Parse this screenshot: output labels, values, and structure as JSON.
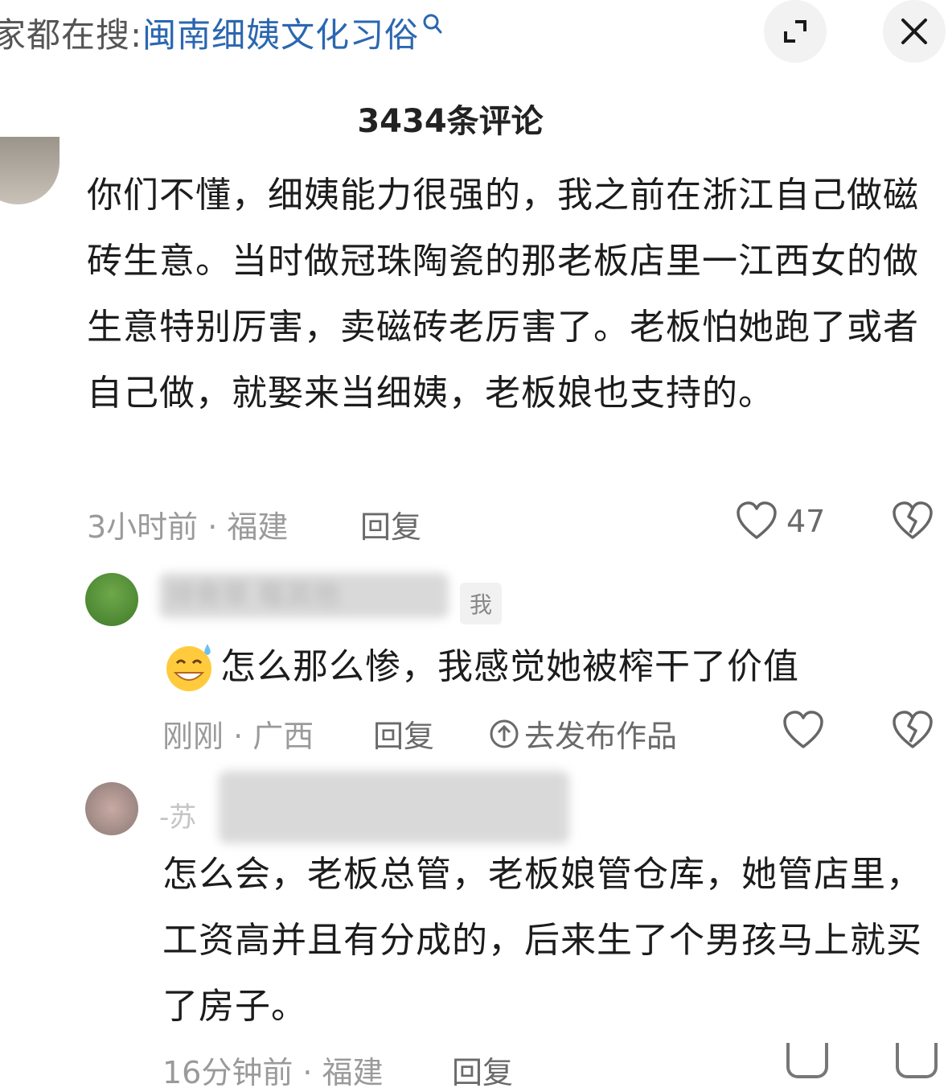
{
  "search": {
    "prefix": "家都在搜:",
    "query": "闽南细姨文化习俗"
  },
  "header": {
    "comment_count": "3434条评论"
  },
  "comments": [
    {
      "text": "你们不懂，细姨能力很强的，我之前在浙江自己做磁砖生意。当时做冠珠陶瓷的那老板店里一江西女的做生意特别厉害，卖磁砖老厉害了。老板怕她跑了或者自己做，就娶来当细姨，老板娘也支持的。",
      "meta": "3小时前 · 福建",
      "reply": "回复",
      "likes": "47"
    },
    {
      "username": "排骨草 莓其他",
      "me_tag": "我",
      "text": "怎么那么惨，我感觉她被榨干了价值",
      "meta": "刚刚 · 广西",
      "reply": "回复",
      "publish": "去发布作品"
    },
    {
      "username": "-苏",
      "text": "怎么会，老板总管，老板娘管仓库，她管店里，工资高并且有分成的，后来生了个男孩马上就买了房子。",
      "meta": "16分钟前 · 福建",
      "reply": "回复"
    }
  ],
  "colors": {
    "link": "#2b67b0",
    "meta": "#9a9a9a",
    "text": "#1c1c1c"
  }
}
